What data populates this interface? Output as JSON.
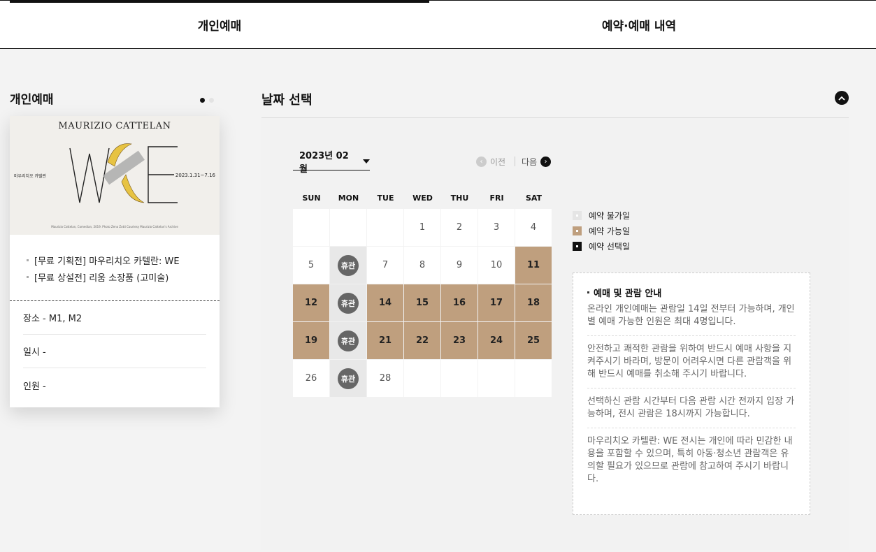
{
  "tabs": [
    {
      "label": "개인예매",
      "active": true
    },
    {
      "label": "예약·예매 내역",
      "active": false
    }
  ],
  "left": {
    "title": "개인예매",
    "poster": {
      "title": "MAURIZIO CATTELAN",
      "left_text": "마우리치오 카텔란",
      "right_text": "2023.1.31~7.16",
      "logo_letters": "WE",
      "credit": "Maurizio Cattelan, Comedian, 2019. Photo Zeno Zotti Courtesy Maurizio Cattelan's Archive"
    },
    "programs": [
      "[무료 기획전] 마우리치오 카텔란: WE",
      "[무료 상설전] 리움 소장품 (고미술)"
    ],
    "info": {
      "place": "장소 - M1, M2",
      "datetime": "일시 -",
      "people": "인원 -"
    }
  },
  "right": {
    "title": "날짜 선택",
    "month_label": "2023년 02월",
    "prev_label": "이전",
    "next_label": "다음",
    "weekdays": [
      "SUN",
      "MON",
      "TUE",
      "WED",
      "THU",
      "FRI",
      "SAT"
    ],
    "closed_label": "휴관",
    "days": [
      {
        "d": "",
        "s": "empty"
      },
      {
        "d": "",
        "s": "empty"
      },
      {
        "d": "",
        "s": "empty"
      },
      {
        "d": "1",
        "s": "normal"
      },
      {
        "d": "2",
        "s": "normal"
      },
      {
        "d": "3",
        "s": "normal"
      },
      {
        "d": "4",
        "s": "normal"
      },
      {
        "d": "5",
        "s": "normal"
      },
      {
        "d": "6",
        "s": "closed"
      },
      {
        "d": "7",
        "s": "normal"
      },
      {
        "d": "8",
        "s": "normal"
      },
      {
        "d": "9",
        "s": "normal"
      },
      {
        "d": "10",
        "s": "normal"
      },
      {
        "d": "11",
        "s": "avail"
      },
      {
        "d": "12",
        "s": "avail"
      },
      {
        "d": "13",
        "s": "closed"
      },
      {
        "d": "14",
        "s": "avail"
      },
      {
        "d": "15",
        "s": "avail"
      },
      {
        "d": "16",
        "s": "avail"
      },
      {
        "d": "17",
        "s": "avail"
      },
      {
        "d": "18",
        "s": "avail"
      },
      {
        "d": "19",
        "s": "avail"
      },
      {
        "d": "20",
        "s": "closed"
      },
      {
        "d": "21",
        "s": "avail"
      },
      {
        "d": "22",
        "s": "avail"
      },
      {
        "d": "23",
        "s": "avail"
      },
      {
        "d": "24",
        "s": "avail"
      },
      {
        "d": "25",
        "s": "avail"
      },
      {
        "d": "26",
        "s": "normal"
      },
      {
        "d": "27",
        "s": "closed"
      },
      {
        "d": "28",
        "s": "normal"
      },
      {
        "d": "",
        "s": "empty"
      },
      {
        "d": "",
        "s": "empty"
      },
      {
        "d": "",
        "s": "empty"
      },
      {
        "d": "",
        "s": "empty"
      }
    ],
    "legend": [
      {
        "label": "예약 불가일",
        "kind": "unavail"
      },
      {
        "label": "예약 가능일",
        "kind": "avail"
      },
      {
        "label": "예약 선택일",
        "kind": "selected"
      }
    ],
    "notice": {
      "title": "예매 및 관람 안내",
      "paragraphs": [
        "온라인 개인예매는 관람일 14일 전부터 가능하며, 개인별 예매 가능한 인원은 최대 4명입니다.",
        "안전하고 쾌적한 관람을 위하여 반드시 예매 사항을 지켜주시기 바라며, 방문이 어려우시면 다른 관람객을 위해 반드시 예매를 취소해 주시기 바랍니다.",
        "선택하신 관람 시간부터 다음 관람 시간 전까지 입장 가능하며, 전시 관람은 18시까지 가능합니다.",
        "마우리치오 카텔란: WE 전시는 개인에 따라 민감한 내용을 포함할 수 있으며, 특히 아동·청소년 관람객은 유의할 필요가 있으므로 관람에 참고하여 주시기 바랍니다."
      ]
    }
  },
  "colors": {
    "available": "#bf9f7e",
    "closed_cell": "#e8e8e8",
    "closed_badge": "#666666",
    "text": "#111111"
  }
}
